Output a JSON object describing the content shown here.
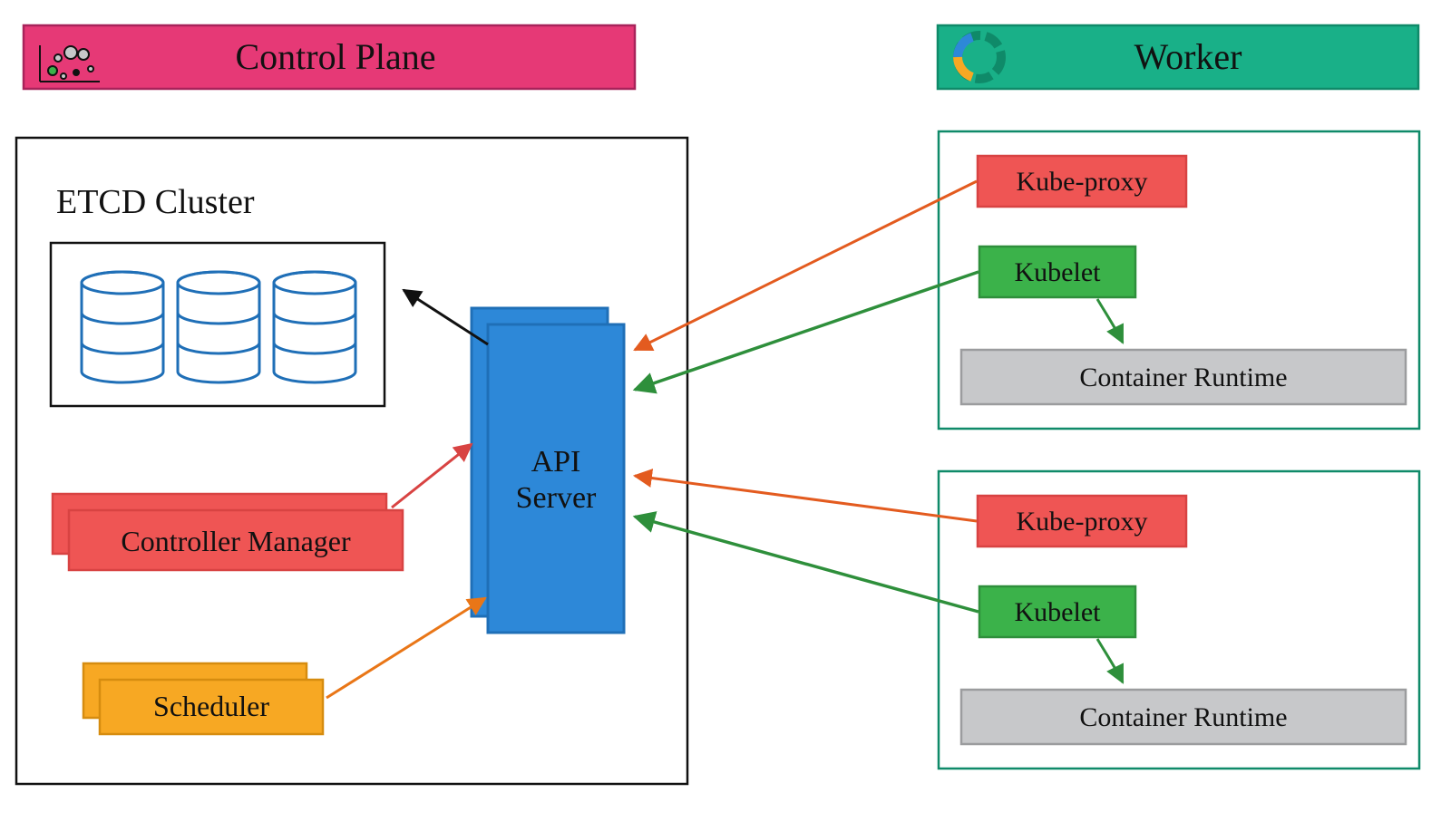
{
  "headers": {
    "control_plane": "Control Plane",
    "worker": "Worker"
  },
  "control_plane": {
    "etcd_cluster": "ETCD Cluster",
    "api_server_line1": "API",
    "api_server_line2": "Server",
    "controller_manager": "Controller Manager",
    "scheduler": "Scheduler"
  },
  "worker": {
    "kube_proxy": "Kube-proxy",
    "kubelet": "Kubelet",
    "container_runtime": "Container Runtime"
  },
  "colors": {
    "pink": "#e63976",
    "teal": "#19b088",
    "tealStroke": "#0f8a69",
    "red": "#ef5554",
    "redDark": "#d84342",
    "orange": "#f7a823",
    "orangeDark": "#d68c0f",
    "blue": "#2d88d8",
    "blueDark": "#1f6fb7",
    "green": "#3bb24a",
    "greenDark": "#2e8f3b",
    "grey": "#c7c8ca",
    "black": "#111"
  }
}
